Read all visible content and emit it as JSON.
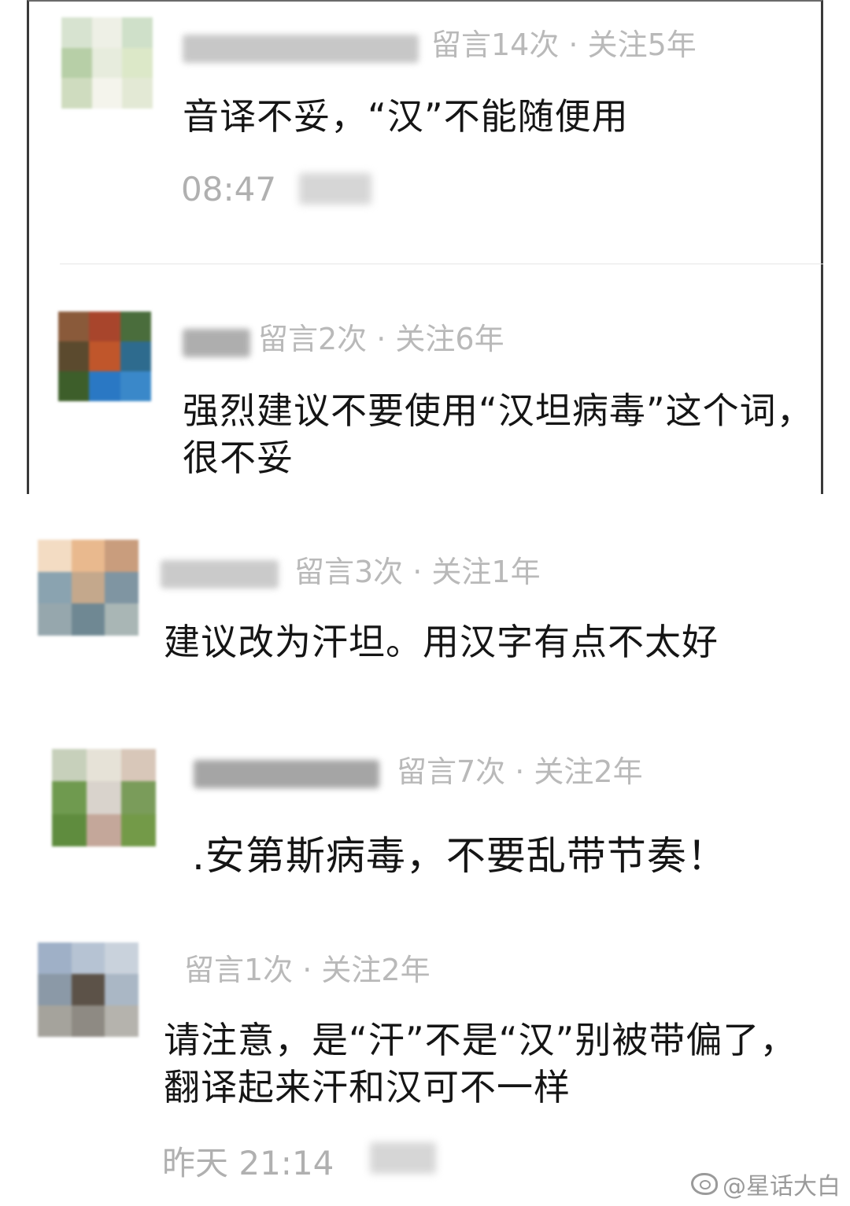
{
  "comments": [
    {
      "meta": "留言14次 · 关注5年",
      "text": "音译不妥，“汉”不能随便用",
      "time": "08:47",
      "avatar_colors": [
        "#d7e3d0",
        "#eef0e6",
        "#cfe0c9",
        "#b7cfa7",
        "#e7ecdd",
        "#dce8c8",
        "#cfdcbf",
        "#f4f4ec",
        "#e3e9d5"
      ]
    },
    {
      "meta": "留言2次 · 关注6年",
      "text": "强烈建议不要使用“汉坦病毒”这个词，很不妥",
      "avatar_colors": [
        "#8a5a3a",
        "#a8452c",
        "#4a6d3c",
        "#5b4a2e",
        "#c0562b",
        "#2e6b8e",
        "#3d5e2a",
        "#2a78c4",
        "#3a88c9"
      ]
    },
    {
      "meta": "留言3次 · 关注1年",
      "text": "建议改为汗坦。用汉字有点不太好",
      "avatar_colors": [
        "#f3dcc3",
        "#e9b98e",
        "#c99d7d",
        "#8aa3b0",
        "#c4a88c",
        "#7f95a2",
        "#96a7ad",
        "#6f8893",
        "#a9b6b5"
      ]
    },
    {
      "meta": "留言7次 · 关注2年",
      "text": ".安第斯病毒，不要乱带节奏！",
      "avatar_colors": [
        "#c7d0bb",
        "#e6e2d7",
        "#d8c7b9",
        "#6f9a4f",
        "#d9d3cc",
        "#7a9c5a",
        "#5f8c3e",
        "#c4a79a",
        "#739a48"
      ]
    },
    {
      "meta": "留言1次 · 关注2年",
      "text": "请注意，是“汗”不是“汉”别被带偏了，翻译起来汗和汉可不一样",
      "time": "昨天 21:14",
      "avatar_colors": [
        "#9fb0c7",
        "#b6c3d3",
        "#c9d2dc",
        "#8b99a7",
        "#5c5248",
        "#aab7c5",
        "#a5a39c",
        "#8e8a83",
        "#b5b3ad"
      ]
    }
  ],
  "watermark": "@星话大白"
}
